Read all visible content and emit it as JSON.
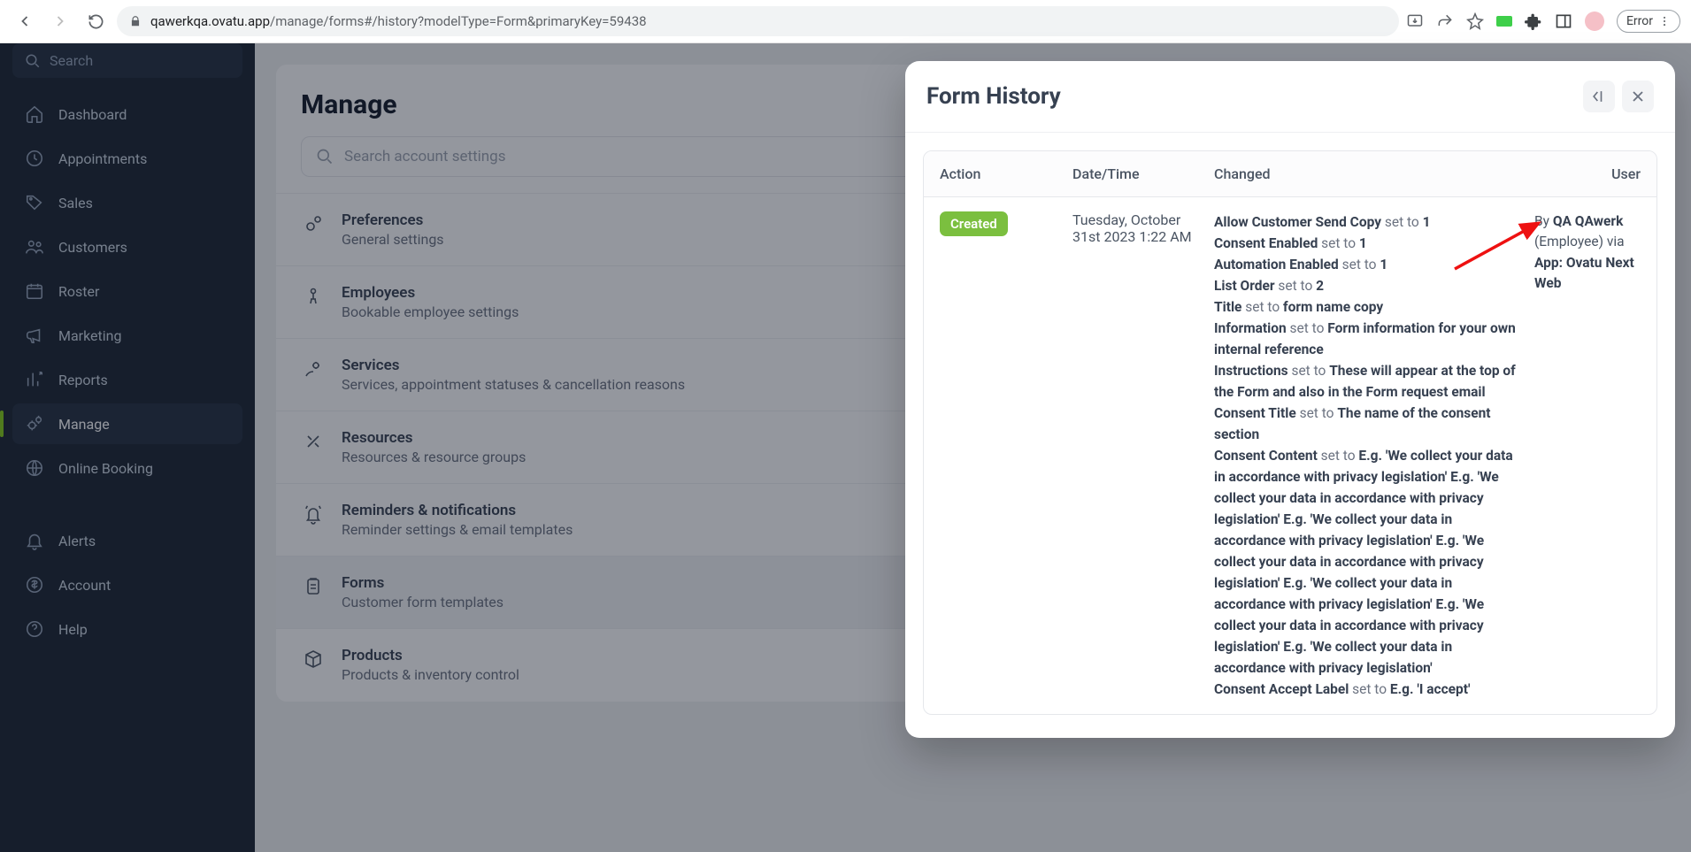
{
  "browser": {
    "url_host": "qawerkqa.ovatu.app",
    "url_path": "/manage/forms#/history?modelType=Form&primaryKey=59438",
    "error_label": "Error"
  },
  "sidebar": {
    "search_placeholder": "Search",
    "items": [
      {
        "label": "Dashboard",
        "icon": "home"
      },
      {
        "label": "Appointments",
        "icon": "clock"
      },
      {
        "label": "Sales",
        "icon": "tag"
      },
      {
        "label": "Customers",
        "icon": "users"
      },
      {
        "label": "Roster",
        "icon": "calendar"
      },
      {
        "label": "Marketing",
        "icon": "megaphone"
      },
      {
        "label": "Reports",
        "icon": "chart"
      },
      {
        "label": "Manage",
        "icon": "gears"
      },
      {
        "label": "Online Booking",
        "icon": "globe"
      }
    ],
    "footer": [
      {
        "label": "Alerts",
        "icon": "bell"
      },
      {
        "label": "Account",
        "icon": "coin"
      },
      {
        "label": "Help",
        "icon": "help"
      }
    ]
  },
  "main": {
    "title": "Manage",
    "search_placeholder": "Search account settings",
    "rows": [
      {
        "title": "Preferences",
        "sub": "General settings",
        "icon": "gears"
      },
      {
        "title": "Employees",
        "sub": "Bookable employee settings",
        "icon": "person"
      },
      {
        "title": "Services",
        "sub": "Services, appointment statuses & cancellation reasons",
        "icon": "gear-hand"
      },
      {
        "title": "Resources",
        "sub": "Resources & resource groups",
        "icon": "tools"
      },
      {
        "title": "Reminders & notifications",
        "sub": "Reminder settings & email templates",
        "icon": "bell-ring"
      },
      {
        "title": "Forms",
        "sub": "Customer form templates",
        "icon": "clipboard"
      },
      {
        "title": "Products",
        "sub": "Products & inventory control",
        "icon": "box"
      }
    ]
  },
  "modal": {
    "title": "Form History",
    "columns": {
      "action": "Action",
      "datetime": "Date/Time",
      "changed": "Changed",
      "user": "User"
    },
    "row": {
      "action_badge": "Created",
      "datetime": "Tuesday, October 31st 2023 1:22 AM",
      "user_by_prefix": "By ",
      "user_name": "QA QAwerk",
      "user_role": " (Employee)",
      "user_via_prefix": " via ",
      "user_app": "App: Ovatu Next Web",
      "setto": " set to ",
      "changes": [
        {
          "field": "Allow Customer Send Copy",
          "value": "1"
        },
        {
          "field": "Consent Enabled",
          "value": "1"
        },
        {
          "field": "Automation Enabled",
          "value": "1"
        },
        {
          "field": "List Order",
          "value": "2"
        },
        {
          "field": "Title",
          "value": "form name copy"
        },
        {
          "field": "Information",
          "value": "Form information for your own internal reference"
        },
        {
          "field": "Instructions",
          "value": "These will appear at the top of the Form and also in the Form request email"
        },
        {
          "field": "Consent Title",
          "value": "The name of the consent section"
        },
        {
          "field": "Consent Content",
          "value": "E.g. 'We collect your data in accordance with privacy legislation' E.g. 'We collect your data in accordance with privacy legislation' E.g. 'We collect your data in accordance with privacy legislation' E.g. 'We collect your data in accordance with privacy legislation' E.g. 'We collect your data in accordance with privacy legislation' E.g. 'We collect your data in accordance with privacy legislation' E.g. 'We collect your data in accordance with privacy legislation'"
        },
        {
          "field": "Consent Accept Label",
          "value": "E.g. 'I accept'"
        }
      ]
    }
  }
}
